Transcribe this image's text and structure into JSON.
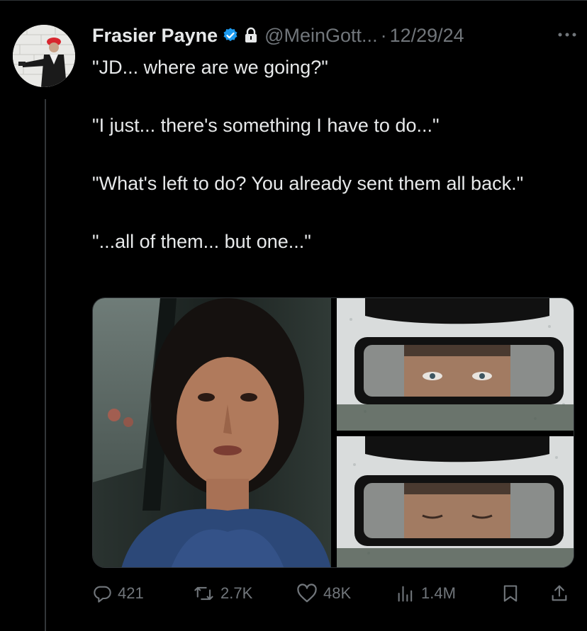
{
  "tweet": {
    "author_name": "Frasier Payne",
    "handle": "@MeinGott...",
    "separator": "·",
    "date": "12/29/24",
    "paragraphs": [
      "\"JD... where are we going?\"",
      "\"I just... there's something I have to do...\"",
      "\"What's left to do? You already sent them all back.\"",
      "\"...all of them... but one...\""
    ]
  },
  "icons": {
    "verified": "verified-badge-icon",
    "lock": "lock-icon",
    "more": "more-options-icon",
    "reply": "reply-icon",
    "retweet": "retweet-icon",
    "like": "heart-icon",
    "views": "views-chart-icon",
    "bookmark": "bookmark-icon",
    "share": "share-icon"
  },
  "actions": {
    "replies": "421",
    "reposts": "2.7K",
    "likes": "48K",
    "views": "1.4M"
  },
  "colors": {
    "background": "#000000",
    "text": "#e7e9ea",
    "muted": "#71767b",
    "verified_blue": "#1d9bf0"
  }
}
